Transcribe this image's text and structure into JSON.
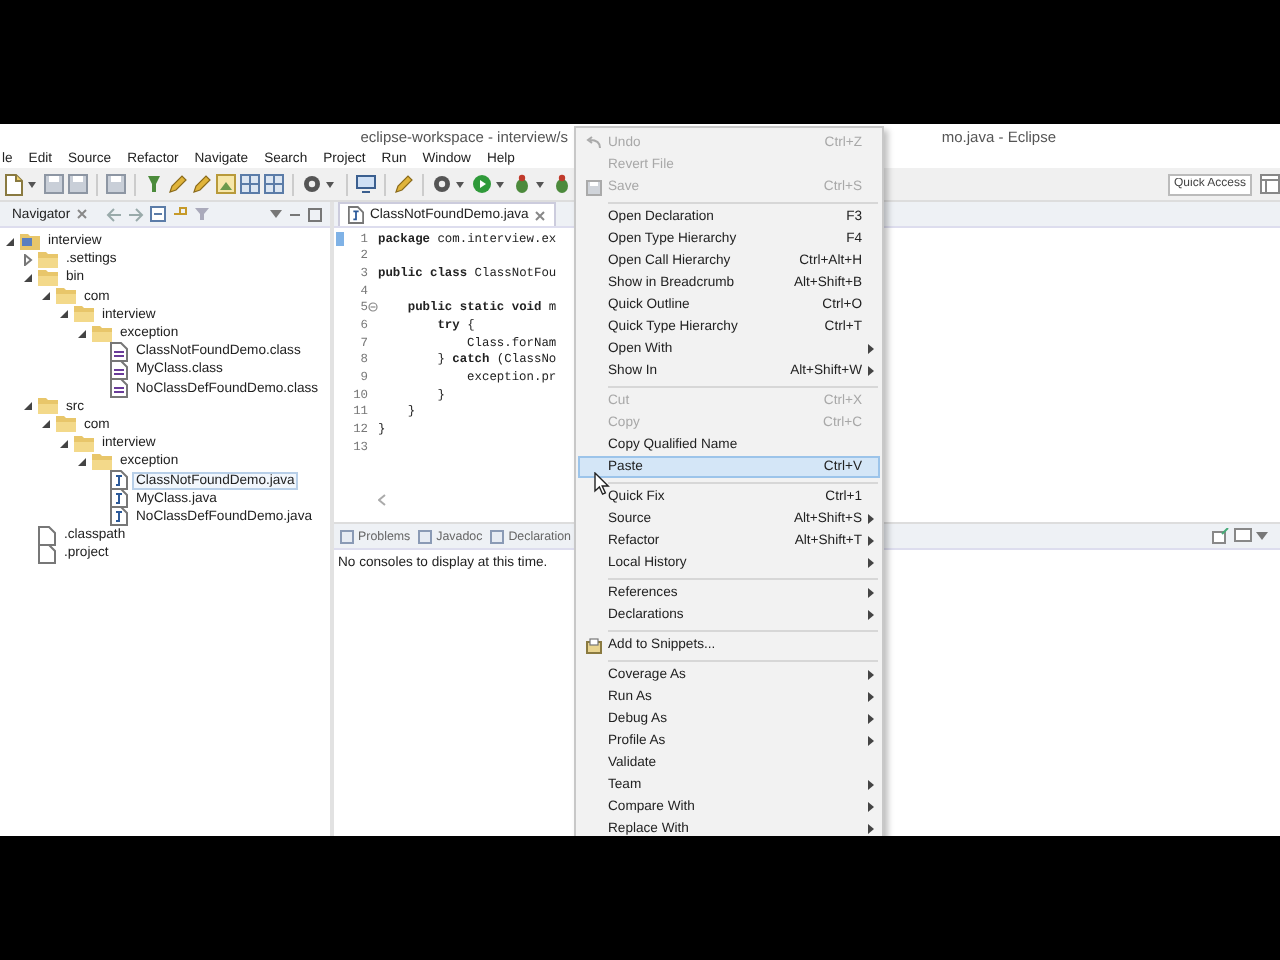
{
  "window": {
    "title_left": "eclipse-workspace - interview/s",
    "title_right": "mo.java - Eclipse"
  },
  "menu_bar": [
    "le",
    "Edit",
    "Source",
    "Refactor",
    "Navigate",
    "Search",
    "Project",
    "Run",
    "Window",
    "Help"
  ],
  "quick_access": {
    "placeholder": "Quick Access"
  },
  "navigator": {
    "tab": "Navigator",
    "tree": [
      {
        "label": "interview",
        "kind": "project",
        "expanded": true,
        "selected": false,
        "children": [
          {
            "label": ".settings",
            "kind": "folder",
            "expanded": false,
            "selected": false
          },
          {
            "label": "bin",
            "kind": "folder",
            "expanded": true,
            "selected": false,
            "children": [
              {
                "label": "com",
                "kind": "folder",
                "expanded": true,
                "selected": false,
                "children": [
                  {
                    "label": "interview",
                    "kind": "folder",
                    "expanded": true,
                    "selected": false,
                    "children": [
                      {
                        "label": "exception",
                        "kind": "folder",
                        "expanded": true,
                        "selected": false,
                        "children": [
                          {
                            "label": "ClassNotFoundDemo.class",
                            "kind": "class",
                            "selected": false
                          },
                          {
                            "label": "MyClass.class",
                            "kind": "class",
                            "selected": false
                          },
                          {
                            "label": "NoClassDefFoundDemo.class",
                            "kind": "class",
                            "selected": false
                          }
                        ]
                      }
                    ]
                  }
                ]
              }
            ]
          },
          {
            "label": "src",
            "kind": "folder",
            "expanded": true,
            "selected": false,
            "children": [
              {
                "label": "com",
                "kind": "folder",
                "expanded": true,
                "selected": false,
                "children": [
                  {
                    "label": "interview",
                    "kind": "folder",
                    "expanded": true,
                    "selected": false,
                    "children": [
                      {
                        "label": "exception",
                        "kind": "folder",
                        "expanded": true,
                        "selected": false,
                        "children": [
                          {
                            "label": "ClassNotFoundDemo.java",
                            "kind": "java",
                            "selected": true
                          },
                          {
                            "label": "MyClass.java",
                            "kind": "java",
                            "selected": false
                          },
                          {
                            "label": "NoClassDefFoundDemo.java",
                            "kind": "java",
                            "selected": false
                          }
                        ]
                      }
                    ]
                  }
                ]
              }
            ]
          },
          {
            "label": ".classpath",
            "kind": "file",
            "selected": false
          },
          {
            "label": ".project",
            "kind": "file",
            "selected": false
          }
        ]
      }
    ]
  },
  "editor": {
    "tab": "ClassNotFoundDemo.java",
    "lines": [
      {
        "number": "1",
        "text": "**package** com.interview.ex",
        "current": true
      },
      {
        "number": "2",
        "current": false
      },
      {
        "number": "3",
        "text": "**public** **class** ClassNotFou",
        "current": false
      },
      {
        "number": "4",
        "current": false
      },
      {
        "number": "5",
        "text": "    **public** **static** **void** m",
        "current": false,
        "foldable": true
      },
      {
        "number": "6",
        "text": "        **try** {",
        "current": false
      },
      {
        "number": "7",
        "text": "            Class.forNam",
        "current": false
      },
      {
        "number": "8",
        "text": "        } **catch** (ClassNo",
        "current": false
      },
      {
        "number": "9",
        "text": "            exception.pr",
        "current": false
      },
      {
        "number": "10",
        "text": "        }",
        "current": false
      },
      {
        "number": "11",
        "text": "    }",
        "current": false
      },
      {
        "number": "12",
        "text": "}",
        "current": false
      },
      {
        "number": "13",
        "current": false
      }
    ]
  },
  "bottom_panel": {
    "tabs": [
      {
        "label": "Problems",
        "selected": false
      },
      {
        "label": "Javadoc",
        "selected": false
      },
      {
        "label": "Declaration",
        "selected": false
      }
    ],
    "message": "No consoles to display at this time."
  },
  "context_menu": [
    {
      "label": "Undo",
      "shortcut": "Ctrl+Z",
      "disabled": true,
      "selected": false
    },
    {
      "label": "Revert File",
      "disabled": true,
      "selected": false
    },
    {
      "label": "Save",
      "shortcut": "Ctrl+S",
      "disabled": true,
      "selected": false
    },
    {
      "kind": "separator"
    },
    {
      "label": "Open Declaration",
      "shortcut": "F3",
      "disabled": false,
      "selected": false
    },
    {
      "label": "Open Type Hierarchy",
      "shortcut": "F4",
      "disabled": false,
      "selected": false
    },
    {
      "label": "Open Call Hierarchy",
      "shortcut": "Ctrl+Alt+H",
      "disabled": false,
      "selected": false
    },
    {
      "label": "Show in Breadcrumb",
      "shortcut": "Alt+Shift+B",
      "disabled": false,
      "selected": false
    },
    {
      "label": "Quick Outline",
      "shortcut": "Ctrl+O",
      "disabled": false,
      "selected": false
    },
    {
      "label": "Quick Type Hierarchy",
      "shortcut": "Ctrl+T",
      "disabled": false,
      "selected": false
    },
    {
      "label": "Open With",
      "disabled": false,
      "selected": false,
      "submenu": true
    },
    {
      "label": "Show In",
      "shortcut": "Alt+Shift+W",
      "disabled": false,
      "selected": false,
      "submenu": true
    },
    {
      "kind": "separator"
    },
    {
      "label": "Cut",
      "shortcut": "Ctrl+X",
      "disabled": true,
      "selected": false
    },
    {
      "label": "Copy",
      "shortcut": "Ctrl+C",
      "disabled": true,
      "selected": false
    },
    {
      "label": "Copy Qualified Name",
      "disabled": false,
      "selected": false
    },
    {
      "label": "Paste",
      "shortcut": "Ctrl+V",
      "disabled": false,
      "selected": true
    },
    {
      "kind": "separator"
    },
    {
      "label": "Quick Fix",
      "shortcut": "Ctrl+1",
      "disabled": false,
      "selected": false
    },
    {
      "label": "Source",
      "shortcut": "Alt+Shift+S",
      "disabled": false,
      "selected": false,
      "submenu": true
    },
    {
      "label": "Refactor",
      "shortcut": "Alt+Shift+T",
      "disabled": false,
      "selected": false,
      "submenu": true
    },
    {
      "label": "Local History",
      "disabled": false,
      "selected": false,
      "submenu": true
    },
    {
      "kind": "separator"
    },
    {
      "label": "References",
      "disabled": false,
      "selected": false,
      "submenu": true
    },
    {
      "label": "Declarations",
      "disabled": false,
      "selected": false,
      "submenu": true
    },
    {
      "kind": "separator"
    },
    {
      "label": "Add to Snippets...",
      "disabled": false,
      "selected": false
    },
    {
      "kind": "separator"
    },
    {
      "label": "Coverage As",
      "disabled": false,
      "selected": false,
      "submenu": true
    },
    {
      "label": "Run As",
      "disabled": false,
      "selected": false,
      "submenu": true
    },
    {
      "label": "Debug As",
      "disabled": false,
      "selected": false,
      "submenu": true
    },
    {
      "label": "Profile As",
      "disabled": false,
      "selected": false,
      "submenu": true
    },
    {
      "label": "Validate",
      "disabled": false,
      "selected": false
    },
    {
      "label": "Team",
      "disabled": false,
      "selected": false,
      "submenu": true
    },
    {
      "label": "Compare With",
      "disabled": false,
      "selected": false,
      "submenu": true
    },
    {
      "label": "Replace With",
      "disabled": false,
      "selected": false,
      "submenu": true
    }
  ]
}
